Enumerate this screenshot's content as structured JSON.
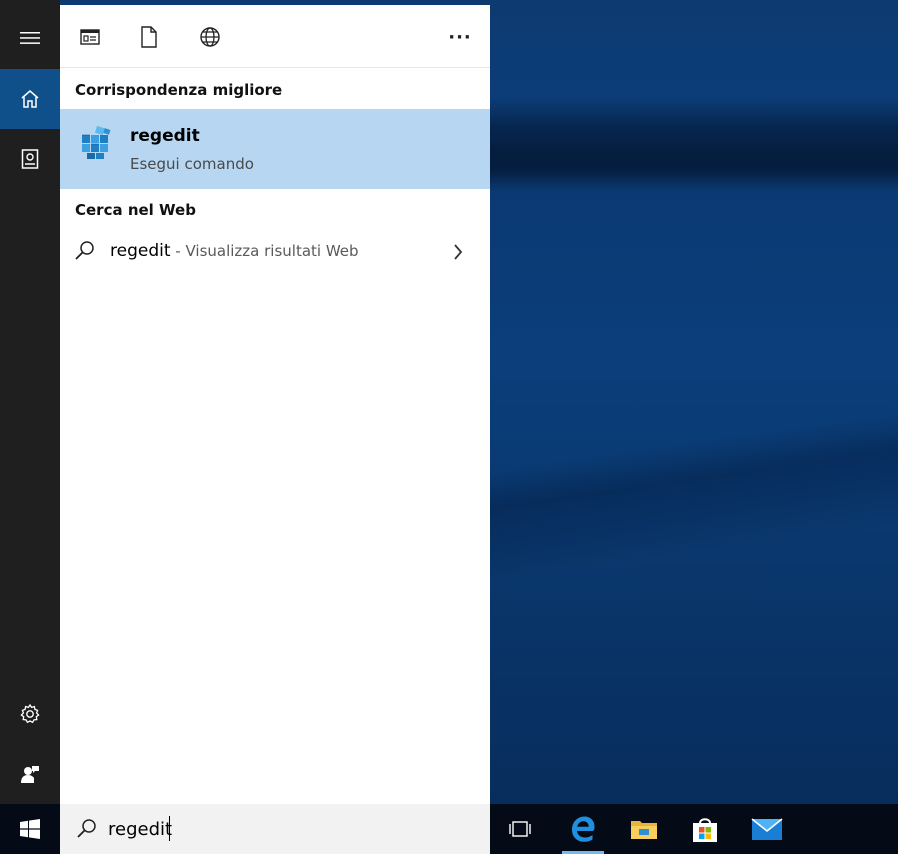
{
  "search_panel": {
    "best_match_header": "Corrispondenza migliore",
    "best_match": {
      "title": "regedit",
      "subtitle": "Esegui comando",
      "icon": "registry-editor-icon"
    },
    "web_header": "Cerca nel Web",
    "web_result": {
      "query": "regedit",
      "suffix": " - Visualizza risultati Web"
    },
    "top_icons": [
      "apps-filter-icon",
      "documents-filter-icon",
      "web-filter-icon"
    ],
    "more_label": "···"
  },
  "rail": {
    "items": [
      "menu-icon",
      "home-icon",
      "notebook-icon",
      "settings-icon",
      "feedback-icon"
    ]
  },
  "taskbar": {
    "search_value": "regedit",
    "items": [
      "task-view-icon",
      "edge-icon",
      "file-explorer-icon",
      "store-icon",
      "mail-icon"
    ]
  },
  "colors": {
    "accent": "#0f4f8a",
    "selection": "#b6d6f2",
    "taskbar": "#050b16",
    "rail": "#1f1f1f"
  }
}
